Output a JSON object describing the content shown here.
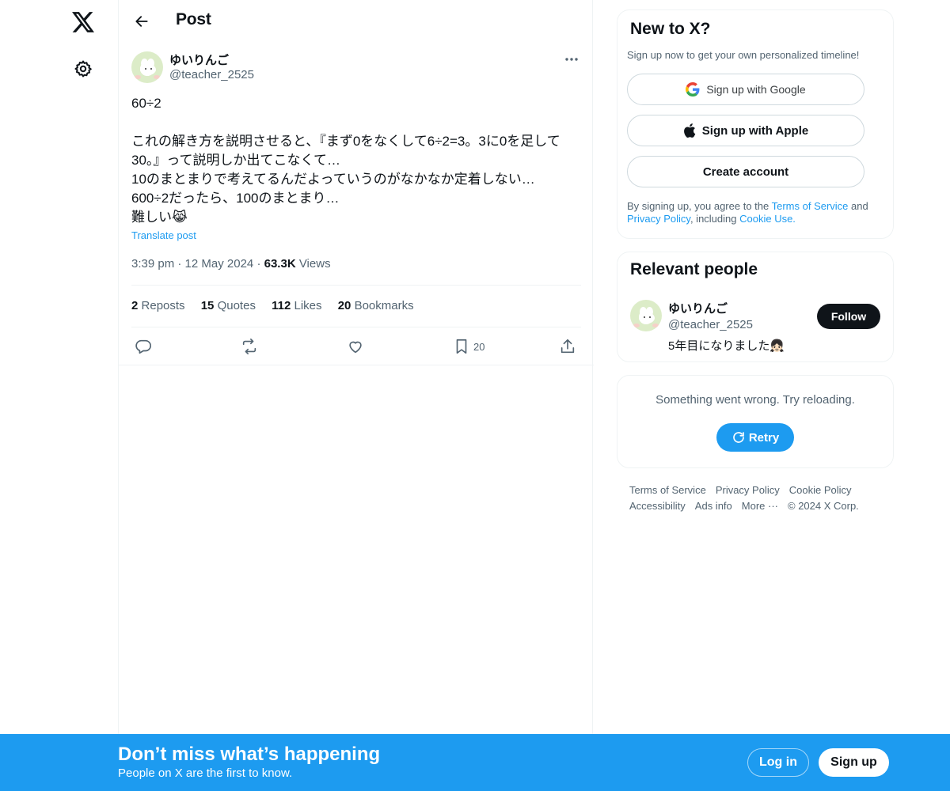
{
  "nav": {
    "logo_icon": "x-logo-icon",
    "settings_icon": "gear-icon"
  },
  "header": {
    "title": "Post"
  },
  "post": {
    "author_name": "ゆいりんご",
    "author_handle": "@teacher_2525",
    "text": "60÷2\n\nこれの解き方を説明させると、『まず0をなくして6÷2=3。3に0を足して30。』って説明しか出てこなくて…\n10のまとまりで考えてるんだよっていうのがなかなか定着しない…\n600÷2だったら、100のまとまり…\n難しい😹",
    "translate": "Translate post",
    "time": "3:39 pm",
    "date": "12 May 2024",
    "views_count": "63.3K",
    "views_label": "Views",
    "reposts_count": "2",
    "reposts_label": "Reposts",
    "quotes_count": "15",
    "quotes_label": "Quotes",
    "likes_count": "112",
    "likes_label": "Likes",
    "bookmarks_count": "20",
    "bookmarks_label": "Bookmarks",
    "bookmark_action_count": "20"
  },
  "signup_card": {
    "title": "New to X?",
    "subtitle": "Sign up now to get your own personalized timeline!",
    "google": "Sign up with Google",
    "apple": "Sign up with Apple",
    "create": "Create account",
    "legal_pre": "By signing up, you agree to the ",
    "terms": "Terms of Service",
    "and": " and ",
    "privacy": "Privacy Policy",
    "including": ", including ",
    "cookie": "Cookie Use."
  },
  "relevant": {
    "title": "Relevant people",
    "name": "ゆいりんご",
    "handle": "@teacher_2525",
    "bio": "5年目になりました👧🏻",
    "follow": "Follow"
  },
  "error_card": {
    "message": "Something went wrong. Try reloading.",
    "retry": "Retry"
  },
  "footer": {
    "terms": "Terms of Service",
    "privacy": "Privacy Policy",
    "cookie": "Cookie Policy",
    "accessibility": "Accessibility",
    "ads": "Ads info",
    "more": "More ···",
    "copyright": "© 2024 X Corp."
  },
  "banner": {
    "title": "Don’t miss what’s happening",
    "subtitle": "People on X are the first to know.",
    "login": "Log in",
    "signup": "Sign up"
  },
  "colors": {
    "accent": "#1d9bf0",
    "text": "#0f1419",
    "muted": "#536471",
    "border": "#eff3f4"
  }
}
